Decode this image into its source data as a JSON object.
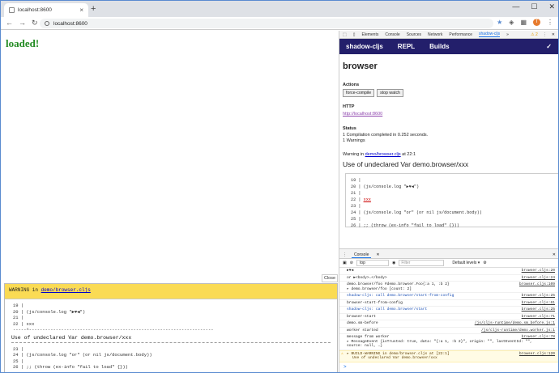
{
  "browser": {
    "tab_title": "localhost:8600",
    "tab_close": "×",
    "new_tab": "+",
    "url": "localhost:8600",
    "window_controls": {
      "minimize": "—",
      "maximize": "☐",
      "close": "✕"
    },
    "nav": {
      "back": "←",
      "forward": "→",
      "reload": "↻"
    },
    "star": "★",
    "avatar_initial": "T",
    "menu": "⋮"
  },
  "page": {
    "loaded_text": "loaded!",
    "close_label": "Close",
    "warning": {
      "prefix": "WARNING in ",
      "file": "demo/browser.cljs",
      "code_lines_top": [
        "19 |",
        "20 | (js/console.log \"▶♥◀\")",
        "21 |",
        "22 | xxx"
      ],
      "marker": "-----^---------------------------------------------------------------------",
      "message": "Use of undeclared Var demo.browser/xxx",
      "code_lines_bottom": [
        "23 |",
        "24 | (js/console.log \"or\" (or nil js/document.body))",
        "25 |",
        "26 | ;; (throw (ex-info \"fail to load\" {}))"
      ]
    }
  },
  "devtools": {
    "tabs": [
      "Elements",
      "Console",
      "Sources",
      "Network",
      "Performance",
      "shadow-cljs"
    ],
    "active_tab": "shadow-cljs",
    "more": "»",
    "warning_count": "⚠ 2",
    "menu": "⋮",
    "close": "✕",
    "shadow": {
      "nav": [
        "shadow-cljs",
        "REPL",
        "Builds"
      ],
      "check": "✓",
      "build_title": "browser",
      "actions_label": "Actions",
      "buttons": [
        "force-compile",
        "stop watch"
      ],
      "http_label": "HTTP",
      "http_link": "http://localhost:8600",
      "status_label": "Status",
      "status_lines": [
        "1 Compilation completed in 0.252 seconds.",
        "1 Warnings"
      ],
      "warning_prefix": "Warning in ",
      "warning_file": "demo/browser.cljs",
      "warning_suffix": " at 22:1",
      "undeclared": "Use of undeclared Var demo.browser/xxx",
      "code": {
        "l19": "19 |",
        "l20": "20 | (js/console.log \"▶♥◀\")",
        "l21": "21 |",
        "l22_prefix": "22 | ",
        "l22_code": "xxx",
        "l23": "23 |",
        "l24": "24 | (js/console.log \"or\" (or nil js/document.body))",
        "l25": "25 |",
        "l26": "26 | ;; (throw (ex-info \"fail to load\" {}))"
      }
    },
    "console": {
      "tab_label": "Console",
      "close": "✕",
      "context": "top",
      "filter_placeholder": "Filter",
      "levels": "Default levels ▾",
      "rows": [
        {
          "msg": "▶♥◀",
          "src": "browser.cljs:20",
          "style": ""
        },
        {
          "msg": "or  ▶<body>…</body>",
          "src": "browser.cljs:24",
          "style": ""
        },
        {
          "msg": "demo.browser/foo #demo.browser.Foo{:a 1, :b 2}",
          "src": "browser.cljs:109",
          "style": ""
        },
        {
          "msg": "▸ demo.browser/foo [count: 2]",
          "src": "browser.cljs:31",
          "style": ""
        },
        {
          "msg": "shadow-cljs: call demo.browser/start-from-config",
          "src": "browser.cljs:25",
          "style": "blue"
        },
        {
          "msg": "browser-start-from-config",
          "src": "browser.cljs:61",
          "style": ""
        },
        {
          "msg": "shadow-cljs: call demo.browser/start",
          "src": "browser.cljs:25",
          "style": "blue"
        },
        {
          "msg": "browser-start",
          "src": "browser.cljs:71",
          "style": ""
        },
        {
          "msg": "demo.sm-before",
          "src": "/js/cljs-runtime/demo.sm_before.js:1",
          "style": ""
        },
        {
          "msg": "worker started",
          "src": "/js/cljs-runtime/demo.worker.js:1",
          "style": ""
        },
        {
          "msg": "message from worker",
          "src": "browser.cljs:78",
          "style": ""
        },
        {
          "msg": "▸ MessageEvent {isTrusted: true, data: \"{:a 1, :b 2}\", origin: \"\", lastEventId: \"\", source: null, …}",
          "src": "",
          "style": ""
        }
      ],
      "warning_row": {
        "line1": "▸ BUILD-WARNING in demo/browser.cljs at [22:1]",
        "line2": "Use of undeclared Var demo.browser/xxx",
        "src": "browser.cljs:120"
      },
      "prompt": ">"
    }
  }
}
